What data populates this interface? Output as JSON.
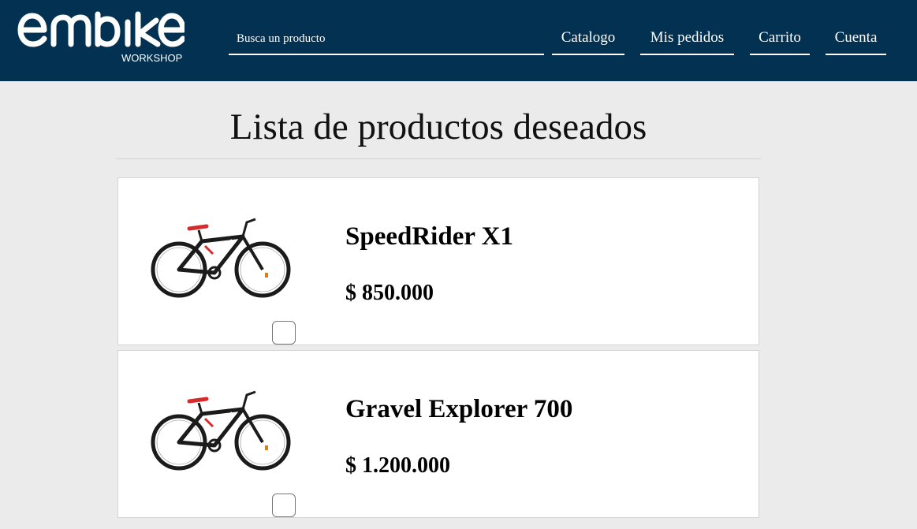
{
  "brand": {
    "subtitle": "WORKSHOP",
    "logo_wordmark": "embike"
  },
  "search": {
    "placeholder": "Busca un producto",
    "value": ""
  },
  "nav": {
    "catalog": "Catalogo",
    "orders": "Mis pedidos",
    "cart": "Carrito",
    "account": "Cuenta"
  },
  "page": {
    "title": "Lista de productos deseados"
  },
  "products": [
    {
      "name": "SpeedRider X1",
      "price": "$ 850.000",
      "image_icon": "bicycle-image",
      "selected": false
    },
    {
      "name": "Gravel Explorer 700",
      "price": "$ 1.200.000",
      "image_icon": "bicycle-image",
      "selected": false
    }
  ],
  "colors": {
    "header_bg": "#033151",
    "page_bg": "#ebebeb",
    "card_bg": "#ffffff",
    "bike_accent": "#d62b2b"
  }
}
